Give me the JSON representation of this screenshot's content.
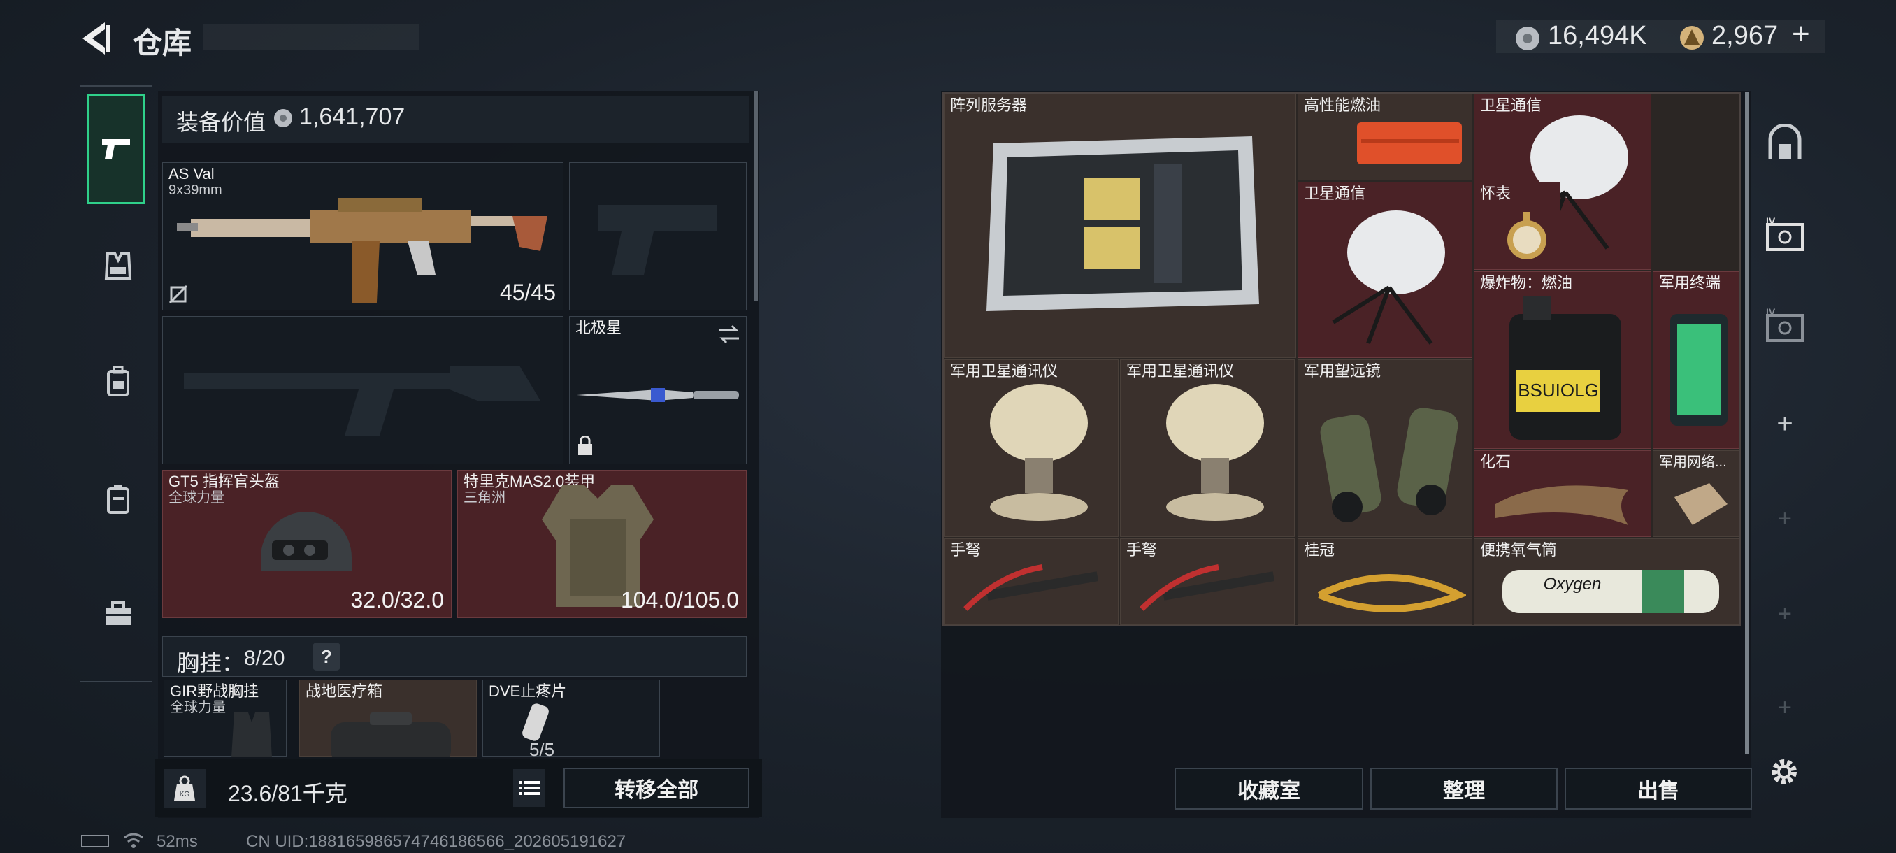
{
  "header": {
    "title": "仓库",
    "currency1": "16,494K",
    "currency2": "2,967",
    "plus": "+"
  },
  "loadout": {
    "equip_value_label": "装备价值",
    "equip_value": "1,641,707",
    "primary": {
      "name": "AS Val",
      "caliber": "9x39mm",
      "ammo": "45/45"
    },
    "melee": {
      "name": "北极星"
    },
    "helmet": {
      "name": "GT5 指挥官头盔",
      "sub": "全球力量",
      "durability": "32.0/32.0"
    },
    "armor": {
      "name": "特里克MAS2.0装甲",
      "sub": "三角洲",
      "durability": "104.0/105.0"
    },
    "rig_label": "胸挂：",
    "rig_count": "8/20",
    "help": "?",
    "rig_items": [
      {
        "name": "GIR野战胸挂",
        "sub": "全球力量"
      },
      {
        "name": "战地医疗箱",
        "sub": ""
      },
      {
        "name": "DVE止疼片",
        "sub": "5/5"
      }
    ],
    "weight": "23.6/81千克",
    "transfer_all": "转移全部"
  },
  "stash": {
    "items": [
      {
        "name": "阵列服务器",
        "bg": "#3a302c"
      },
      {
        "name": "高性能燃油",
        "bg": "#3a302c"
      },
      {
        "name": "卫星通信",
        "bg": "#4a2226"
      },
      {
        "name": "卫星通信",
        "bg": "#4a2226"
      },
      {
        "name": "怀表",
        "bg": "#4a2226"
      },
      {
        "name": "爆炸物：燃油",
        "bg": "#4a2226"
      },
      {
        "name": "军用终端",
        "bg": "#4a2226"
      },
      {
        "name": "军用卫星通讯仪",
        "bg": "#3a302c"
      },
      {
        "name": "军用卫星通讯仪",
        "bg": "#3a302c"
      },
      {
        "name": "军用望远镜",
        "bg": "#3a302c"
      },
      {
        "name": "化石",
        "bg": "#4a2226"
      },
      {
        "name": "军用网络...",
        "bg": "#3a302c"
      },
      {
        "name": "手弩",
        "bg": "#3a302c"
      },
      {
        "name": "手弩",
        "bg": "#3a302c"
      },
      {
        "name": "桂冠",
        "bg": "#3a302c"
      },
      {
        "name": "便携氧气筒",
        "bg": "#3a302c"
      }
    ],
    "fuel_label": "BSUIOLG",
    "oxygen_label": "Oxygen"
  },
  "actions": {
    "collection": "收藏室",
    "organize": "整理",
    "sell": "出售"
  },
  "status": {
    "ping": "52ms",
    "uid": "CN UID:188165986574746186566_202605191627"
  },
  "colors": {
    "accent_green": "#2fd08a",
    "rare_red": "#4a2226",
    "common_brown": "#3a302c"
  }
}
